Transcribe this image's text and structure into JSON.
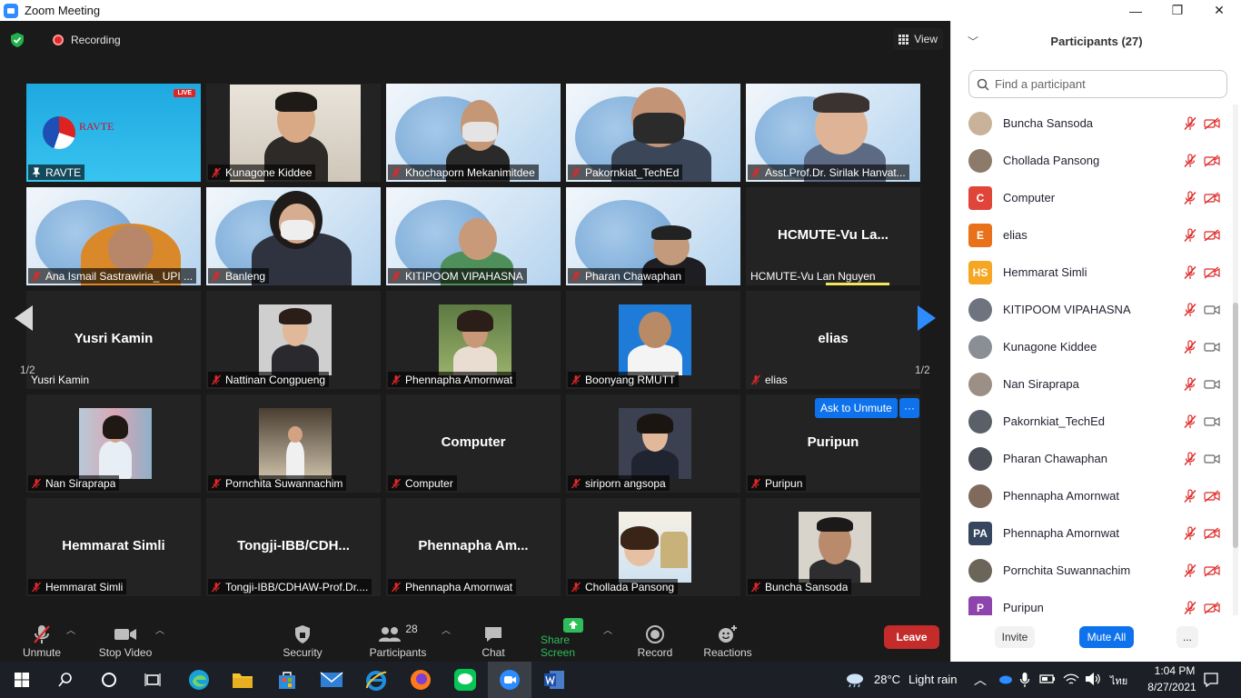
{
  "window": {
    "title": "Zoom Meeting",
    "minimize": "—",
    "maximize": "❐",
    "close": "✕"
  },
  "meeting": {
    "recording_label": "Recording",
    "view_label": "View",
    "page_indicator": "1/2",
    "ask_to_unmute_label": "Ask to Unmute",
    "more_label": "···",
    "live_badge": "LIVE",
    "ravte_banner": "RAVTE",
    "tiles": [
      {
        "name": "RAVTE",
        "center": ""
      },
      {
        "name": "Kunagone Kiddee",
        "center": ""
      },
      {
        "name": "Khochaporn Mekanimitdee",
        "center": ""
      },
      {
        "name": "Pakornkiat_TechEd",
        "center": ""
      },
      {
        "name": "Asst.Prof.Dr. Sirilak Hanvat...",
        "center": ""
      },
      {
        "name": "Ana Ismail Sastrawiria_ UPI ...",
        "center": ""
      },
      {
        "name": "Banleng",
        "center": ""
      },
      {
        "name": "KITIPOOM VIPAHASNA",
        "center": ""
      },
      {
        "name": "Pharan Chawaphan",
        "center": ""
      },
      {
        "name": "HCMUTE-Vu Lan Nguyen",
        "center": "HCMUTE-Vu  La..."
      },
      {
        "name": "Yusri Kamin",
        "center": "Yusri Kamin"
      },
      {
        "name": "Nattinan Congpueng",
        "center": ""
      },
      {
        "name": "Phennapha Amornwat",
        "center": ""
      },
      {
        "name": "Boonyang RMUTT",
        "center": ""
      },
      {
        "name": "elias",
        "center": "elias"
      },
      {
        "name": "Nan Siraprapa",
        "center": ""
      },
      {
        "name": "Pornchita Suwannachim",
        "center": ""
      },
      {
        "name": "Computer",
        "center": "Computer"
      },
      {
        "name": "siriporn angsopa",
        "center": ""
      },
      {
        "name": "Puripun",
        "center": "Puripun"
      },
      {
        "name": "Hemmarat Simli",
        "center": "Hemmarat Simli"
      },
      {
        "name": "Tongji-IBB/CDHAW-Prof.Dr....",
        "center": "Tongji-IBB/CDH..."
      },
      {
        "name": "Phennapha Amornwat",
        "center": "Phennapha  Am..."
      },
      {
        "name": "Chollada Pansong",
        "center": ""
      },
      {
        "name": "Buncha Sansoda",
        "center": ""
      }
    ]
  },
  "toolbar": {
    "unmute": "Unmute",
    "stop_video": "Stop Video",
    "security": "Security",
    "participants": "Participants",
    "participants_count": "28",
    "chat": "Chat",
    "share_screen": "Share Screen",
    "record": "Record",
    "reactions": "Reactions",
    "leave": "Leave"
  },
  "panel": {
    "title": "Participants (27)",
    "search_placeholder": "Find a participant",
    "participants": [
      {
        "name": "Buncha Sansoda",
        "initials": "",
        "color": "#c9b29a",
        "video": "off"
      },
      {
        "name": "Chollada Pansong",
        "initials": "",
        "color": "#8c7b6a",
        "video": "off"
      },
      {
        "name": "Computer",
        "initials": "C",
        "color": "#e0453a",
        "video": "off"
      },
      {
        "name": "elias",
        "initials": "E",
        "color": "#e8711a",
        "video": "off"
      },
      {
        "name": "Hemmarat Simli",
        "initials": "HS",
        "color": "#f5a623",
        "video": "off"
      },
      {
        "name": "KITIPOOM VIPAHASNA",
        "initials": "",
        "color": "#6d7480",
        "video": "on"
      },
      {
        "name": "Kunagone Kiddee",
        "initials": "",
        "color": "#8a8f96",
        "video": "on"
      },
      {
        "name": "Nan Siraprapa",
        "initials": "",
        "color": "#9b8f86",
        "video": "on"
      },
      {
        "name": "Pakornkiat_TechEd",
        "initials": "",
        "color": "#5a6068",
        "video": "on"
      },
      {
        "name": "Pharan Chawaphan",
        "initials": "",
        "color": "#4b5058",
        "video": "on"
      },
      {
        "name": "Phennapha Amornwat",
        "initials": "",
        "color": "#7f6a5c",
        "video": "off"
      },
      {
        "name": "Phennapha Amornwat",
        "initials": "PA",
        "color": "#36465e",
        "video": "off"
      },
      {
        "name": "Pornchita Suwannachim",
        "initials": "",
        "color": "#6b6459",
        "video": "off"
      },
      {
        "name": "Puripun",
        "initials": "P",
        "color": "#8e44ad",
        "video": "off"
      }
    ],
    "invite": "Invite",
    "mute_all": "Mute All",
    "more": "..."
  },
  "taskbar": {
    "temperature": "28°C",
    "weather": "Light rain",
    "language": "ไทย",
    "time": "1:04 PM",
    "date": "8/27/2021"
  },
  "colors": {
    "accent": "#0e72ed",
    "leave": "#c42b2b",
    "muted": "#e02828",
    "share": "#2dbd5a"
  }
}
